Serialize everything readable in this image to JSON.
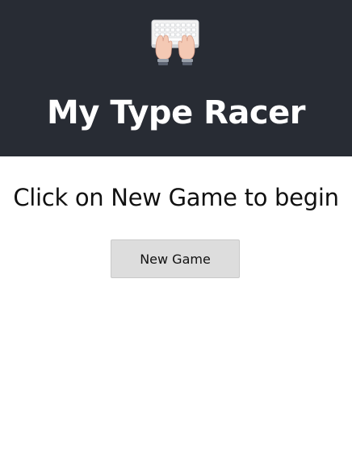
{
  "header": {
    "logo_icon": "keyboard-hands-icon",
    "title": "My Type Racer",
    "background_color": "#282c34"
  },
  "main": {
    "prompt": "Click on New Game to begin",
    "new_game_label": "New Game",
    "button_color": "#dddddd"
  }
}
